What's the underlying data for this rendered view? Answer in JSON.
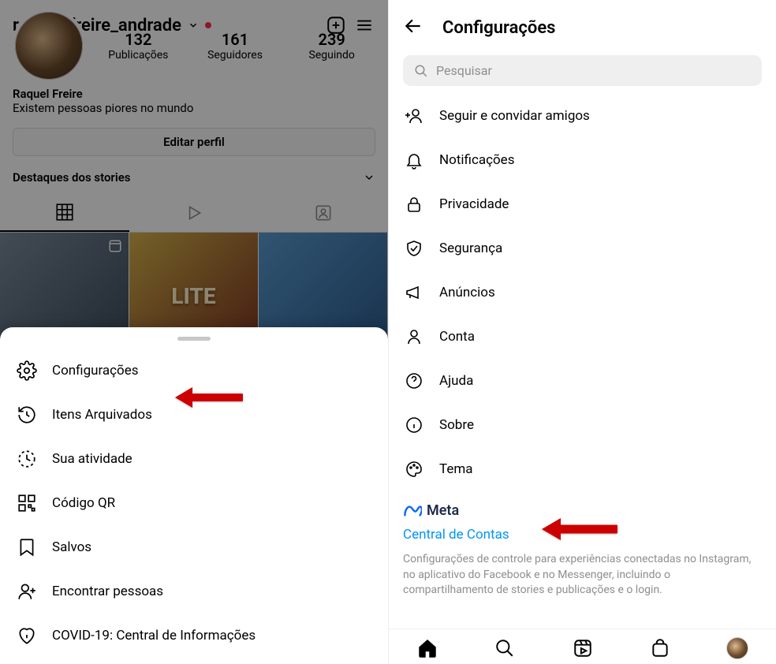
{
  "left": {
    "username": "raquel_freire_andrade",
    "stats": {
      "posts": {
        "value": "132",
        "label": "Publicações"
      },
      "followers": {
        "value": "161",
        "label": "Seguidores"
      },
      "following": {
        "value": "239",
        "label": "Seguindo"
      }
    },
    "bio": {
      "name": "Raquel Freire",
      "description": "Existem pessoas piores no mundo"
    },
    "edit_profile_label": "Editar perfil",
    "highlights_label": "Destaques dos stories",
    "sheet": {
      "items": [
        {
          "key": "configuracoes",
          "label": "Configurações",
          "icon": "gear-icon"
        },
        {
          "key": "arquivados",
          "label": "Itens Arquivados",
          "icon": "archive-clock-icon"
        },
        {
          "key": "atividade",
          "label": "Sua atividade",
          "icon": "activity-clock-icon"
        },
        {
          "key": "codigo-qr",
          "label": "Código QR",
          "icon": "qr-icon"
        },
        {
          "key": "salvos",
          "label": "Salvos",
          "icon": "save-icon"
        },
        {
          "key": "pessoas",
          "label": "Encontrar pessoas",
          "icon": "find-people-icon"
        },
        {
          "key": "covid",
          "label": "COVID-19: Central de Informações",
          "icon": "info-heart-icon"
        }
      ]
    },
    "grid_text": "LITE"
  },
  "right": {
    "title": "Configurações",
    "search_placeholder": "Pesquisar",
    "items": [
      {
        "key": "seguir",
        "label": "Seguir e convidar amigos",
        "icon": "add-person-icon"
      },
      {
        "key": "notif",
        "label": "Notificações",
        "icon": "bell-icon"
      },
      {
        "key": "priv",
        "label": "Privacidade",
        "icon": "lock-icon"
      },
      {
        "key": "seg",
        "label": "Segurança",
        "icon": "shield-icon"
      },
      {
        "key": "anuncios",
        "label": "Anúncios",
        "icon": "megaphone-icon"
      },
      {
        "key": "conta",
        "label": "Conta",
        "icon": "person-icon"
      },
      {
        "key": "ajuda",
        "label": "Ajuda",
        "icon": "help-icon"
      },
      {
        "key": "sobre",
        "label": "Sobre",
        "icon": "info-icon"
      },
      {
        "key": "tema",
        "label": "Tema",
        "icon": "palette-icon"
      }
    ],
    "meta": {
      "brand": "Meta",
      "link": "Central de Contas",
      "description": "Configurações de controle para experiências conectadas no Instagram, no aplicativo do Facebook e no Messenger, incluindo o compartilhamento de stories e publicações e o login."
    }
  }
}
